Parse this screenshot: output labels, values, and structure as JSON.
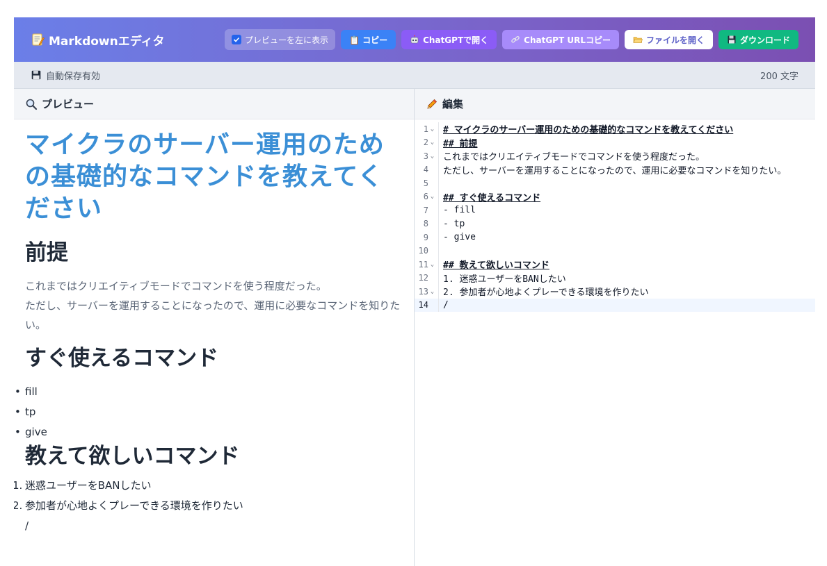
{
  "app": {
    "title": "Markdownエディタ",
    "logo_icon": "memo-icon"
  },
  "toolbar": {
    "preview_left_label": "プレビューを左に表示",
    "preview_left_checked": true,
    "copy_label": "📋 コピー",
    "chatgpt_label": "ChatGPTで開く",
    "chatgpt_url_label": "ChatGPT URLコピー",
    "open_file_label": "ファイルを開く",
    "download_label": "ダウンロード"
  },
  "status": {
    "autosave_label": "自動保存有効",
    "char_count": "200 文字"
  },
  "preview": {
    "header_label": "プレビュー",
    "h1": "マイクラのサーバー運用のための基礎的なコマンドを教えてください",
    "section1_title": "前提",
    "section1_line1": "これまではクリエイティブモードでコマンドを使う程度だった。",
    "section1_line2": "ただし、サーバーを運用することになったので、運用に必要なコマンドを知りたい。",
    "section2_title": "すぐ使えるコマンド",
    "section2_items": [
      "fill",
      "tp",
      "give"
    ],
    "section3_title": "教えて欲しいコマンド",
    "section3_items": [
      "迷惑ユーザーをBANしたい",
      "参加者が心地よくプレーできる環境を作りたい"
    ],
    "section3_nums": [
      "1.",
      "2."
    ],
    "trailing": "/"
  },
  "editor": {
    "header_label": "編集",
    "lines": [
      {
        "num": "1",
        "fold": true,
        "text": "# マイクラのサーバー運用のための基礎的なコマンドを教えてください",
        "heading": true
      },
      {
        "num": "2",
        "fold": true,
        "text": "## 前提",
        "heading": true
      },
      {
        "num": "3",
        "fold": true,
        "text": "これまではクリエイティブモードでコマンドを使う程度だった。",
        "heading": false
      },
      {
        "num": "4",
        "fold": false,
        "text": "ただし、サーバーを運用することになったので、運用に必要なコマンドを知りたい。",
        "heading": false
      },
      {
        "num": "5",
        "fold": false,
        "text": "",
        "heading": false
      },
      {
        "num": "6",
        "fold": true,
        "text": "## すぐ使えるコマンド",
        "heading": true
      },
      {
        "num": "7",
        "fold": false,
        "text": "- fill",
        "heading": false
      },
      {
        "num": "8",
        "fold": false,
        "text": "- tp",
        "heading": false
      },
      {
        "num": "9",
        "fold": false,
        "text": "- give",
        "heading": false
      },
      {
        "num": "10",
        "fold": false,
        "text": "",
        "heading": false
      },
      {
        "num": "11",
        "fold": true,
        "text": "## 教えて欲しいコマンド",
        "heading": true
      },
      {
        "num": "12",
        "fold": false,
        "text": "1. 迷惑ユーザーをBANしたい",
        "heading": false
      },
      {
        "num": "13",
        "fold": true,
        "text": "2. 参加者が心地よくプレーできる環境を作りたい",
        "heading": false
      },
      {
        "num": "14",
        "fold": false,
        "text": "/",
        "heading": false,
        "active": true
      }
    ]
  },
  "colors": {
    "header_start": "#6b7fe8",
    "header_end": "#7b4fb2",
    "copy": "#3b82f6",
    "chatgpt": "#8b5cf6",
    "chatgpt_url": "#a78bfa",
    "download": "#10b981",
    "h1": "#3b8fd6"
  }
}
